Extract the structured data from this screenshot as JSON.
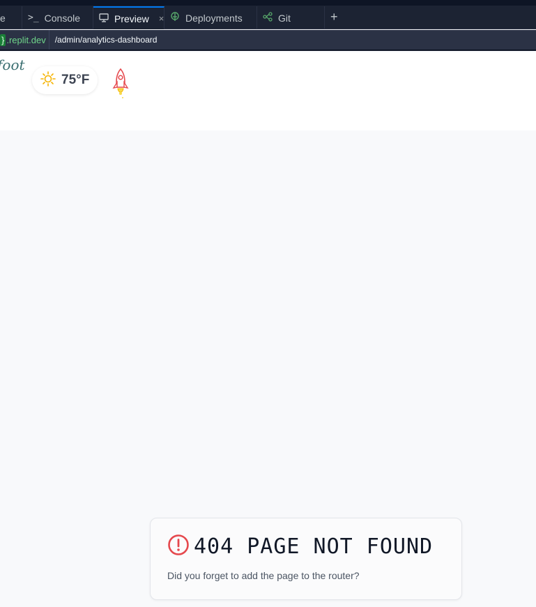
{
  "tabs": [
    {
      "label": "e",
      "icon": "file-icon"
    },
    {
      "label": "Console",
      "icon": "terminal-icon"
    },
    {
      "label": "Preview",
      "icon": "monitor-icon",
      "active": true
    },
    {
      "label": "Deployments",
      "icon": "deploy-icon"
    },
    {
      "label": "Git",
      "icon": "git-icon"
    }
  ],
  "tab_close": "×",
  "new_tab": "+",
  "url": {
    "host_brace": "}",
    "host": ".replit.dev",
    "path": "/admin/analytics-dashboard"
  },
  "header": {
    "logo_text": "foot",
    "weather": {
      "temp": "75°F",
      "icon": "sun-icon"
    },
    "rocket_icon": "rocket-icon"
  },
  "error": {
    "title": "404 PAGE NOT FOUND",
    "message": "Did you forget to add the page to the router?",
    "icon": "alert-circle-icon"
  },
  "colors": {
    "tabbar_bg": "#1c2333",
    "accent_blue": "#0079f2",
    "host_green": "#6fd58a",
    "error_red": "#e5484d",
    "page_bg": "#f8f9fb"
  }
}
